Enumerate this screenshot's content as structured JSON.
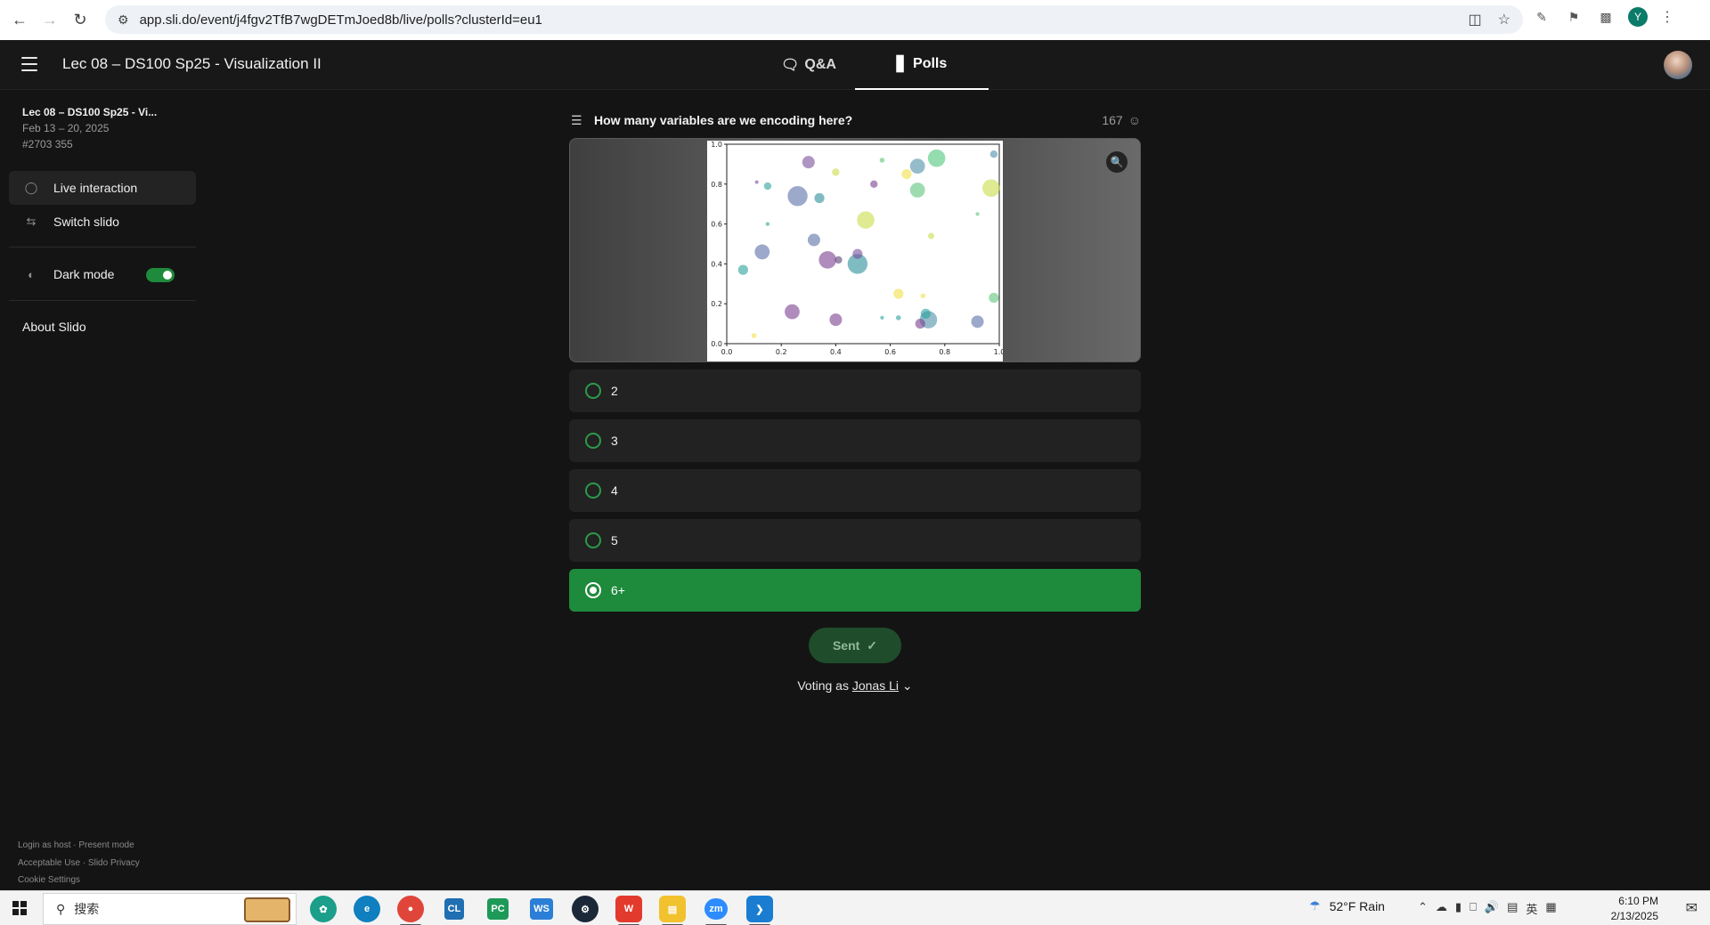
{
  "browser": {
    "url": "app.sli.do/event/j4fgv2TfB7wgDETmJoed8b/live/polls?clusterId=eu1",
    "profile_initial": "Y"
  },
  "header": {
    "event_title": "Lec 08 – DS100 Sp25 - Visualization II",
    "tabs": [
      {
        "label": "Q&A"
      },
      {
        "label": "Polls"
      }
    ]
  },
  "sidebar": {
    "event_name": "Lec 08 – DS100 Sp25 - Vi...",
    "dates": "Feb 13 – 20, 2025",
    "code": "#2703 355",
    "items": [
      {
        "label": "Live interaction"
      },
      {
        "label": "Switch slido"
      },
      {
        "label": "Dark mode"
      }
    ],
    "dark_mode_on": true,
    "about": "About Slido",
    "footer": {
      "line1": "Login as host · Present mode",
      "line2": "Acceptable Use · Slido Privacy",
      "line3": "Cookie Settings"
    }
  },
  "poll": {
    "question": "How many variables are we encoding here?",
    "participants": "167",
    "options": [
      {
        "label": "2",
        "selected": false
      },
      {
        "label": "3",
        "selected": false
      },
      {
        "label": "4",
        "selected": false
      },
      {
        "label": "5",
        "selected": false
      },
      {
        "label": "6+",
        "selected": true
      }
    ],
    "sent_label": "Sent",
    "voting_prefix": "Voting as",
    "voter_name": "Jonas Li"
  },
  "chart_data": {
    "type": "scatter",
    "xlim": [
      0.0,
      1.0
    ],
    "ylim": [
      0.0,
      1.0
    ],
    "x_ticks": [
      "0.0",
      "0.2",
      "0.4",
      "0.6",
      "0.8",
      "1.0"
    ],
    "y_ticks": [
      "0.0",
      "0.2",
      "0.4",
      "0.6",
      "0.8",
      "1.0"
    ],
    "points": [
      {
        "x": 0.3,
        "y": 0.91,
        "size": 0.05,
        "color": "#7a4f9a"
      },
      {
        "x": 0.4,
        "y": 0.86,
        "size": 0.03,
        "color": "#c9dc4a"
      },
      {
        "x": 0.57,
        "y": 0.92,
        "size": 0.02,
        "color": "#5dc47b"
      },
      {
        "x": 0.7,
        "y": 0.89,
        "size": 0.06,
        "color": "#4f8fa8"
      },
      {
        "x": 0.77,
        "y": 0.93,
        "size": 0.07,
        "color": "#4cc67a"
      },
      {
        "x": 0.66,
        "y": 0.85,
        "size": 0.04,
        "color": "#f0e04a"
      },
      {
        "x": 0.98,
        "y": 0.95,
        "size": 0.03,
        "color": "#4f8fa8"
      },
      {
        "x": 0.15,
        "y": 0.79,
        "size": 0.03,
        "color": "#2aa199"
      },
      {
        "x": 0.26,
        "y": 0.74,
        "size": 0.08,
        "color": "#5a70a8"
      },
      {
        "x": 0.34,
        "y": 0.73,
        "size": 0.04,
        "color": "#2a8f9a"
      },
      {
        "x": 0.54,
        "y": 0.8,
        "size": 0.03,
        "color": "#7a3f8f"
      },
      {
        "x": 0.7,
        "y": 0.77,
        "size": 0.06,
        "color": "#5dc47b"
      },
      {
        "x": 0.97,
        "y": 0.78,
        "size": 0.07,
        "color": "#c9dc4a"
      },
      {
        "x": 0.11,
        "y": 0.81,
        "size": 0.015,
        "color": "#7a4f9a"
      },
      {
        "x": 0.51,
        "y": 0.62,
        "size": 0.07,
        "color": "#c9dc4a"
      },
      {
        "x": 0.32,
        "y": 0.52,
        "size": 0.05,
        "color": "#5a70a8"
      },
      {
        "x": 0.75,
        "y": 0.54,
        "size": 0.025,
        "color": "#c9dc4a"
      },
      {
        "x": 0.92,
        "y": 0.65,
        "size": 0.015,
        "color": "#5dc47b"
      },
      {
        "x": 0.13,
        "y": 0.46,
        "size": 0.06,
        "color": "#5a70a8"
      },
      {
        "x": 0.06,
        "y": 0.37,
        "size": 0.04,
        "color": "#2aa199"
      },
      {
        "x": 0.37,
        "y": 0.42,
        "size": 0.07,
        "color": "#7a3f8f"
      },
      {
        "x": 0.48,
        "y": 0.4,
        "size": 0.08,
        "color": "#2a8f9a"
      },
      {
        "x": 0.48,
        "y": 0.45,
        "size": 0.04,
        "color": "#7a4f9a"
      },
      {
        "x": 0.41,
        "y": 0.42,
        "size": 0.03,
        "color": "#5a3f7a"
      },
      {
        "x": 0.15,
        "y": 0.6,
        "size": 0.015,
        "color": "#2aa199"
      },
      {
        "x": 0.63,
        "y": 0.25,
        "size": 0.04,
        "color": "#f0e04a"
      },
      {
        "x": 0.72,
        "y": 0.24,
        "size": 0.02,
        "color": "#f0e04a"
      },
      {
        "x": 0.98,
        "y": 0.23,
        "size": 0.04,
        "color": "#5dc47b"
      },
      {
        "x": 0.24,
        "y": 0.16,
        "size": 0.06,
        "color": "#7a3f8f"
      },
      {
        "x": 0.4,
        "y": 0.12,
        "size": 0.05,
        "color": "#7a3f8f"
      },
      {
        "x": 0.57,
        "y": 0.13,
        "size": 0.015,
        "color": "#2aa199"
      },
      {
        "x": 0.63,
        "y": 0.13,
        "size": 0.02,
        "color": "#2aa199"
      },
      {
        "x": 0.74,
        "y": 0.12,
        "size": 0.07,
        "color": "#4f8fa8"
      },
      {
        "x": 0.71,
        "y": 0.1,
        "size": 0.04,
        "color": "#7a3f8f"
      },
      {
        "x": 0.73,
        "y": 0.15,
        "size": 0.04,
        "color": "#2aa199"
      },
      {
        "x": 0.92,
        "y": 0.11,
        "size": 0.05,
        "color": "#5a70a8"
      },
      {
        "x": 0.1,
        "y": 0.04,
        "size": 0.02,
        "color": "#f0e04a"
      }
    ]
  },
  "taskbar": {
    "search_placeholder": "搜索",
    "weather": "52°F  Rain",
    "ime": "英",
    "time": "6:10 PM",
    "date": "2/13/2025",
    "apps": [
      {
        "label": "CL",
        "color": "#1f6fb2"
      },
      {
        "label": "PC",
        "color": "#1d9a57"
      },
      {
        "label": "WS",
        "color": "#2b7fd6"
      },
      {
        "label": "zm",
        "color": "#2d8cff"
      }
    ]
  }
}
